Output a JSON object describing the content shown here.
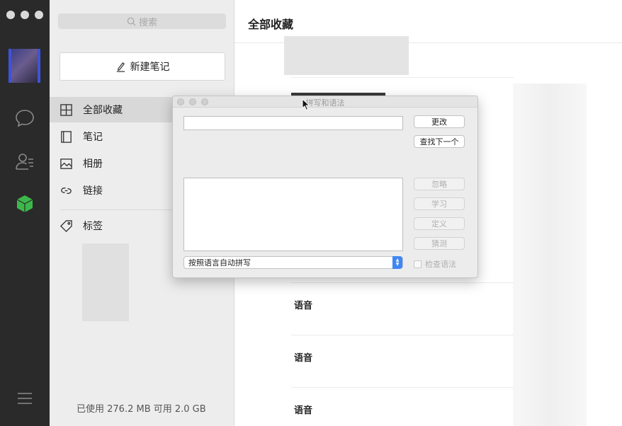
{
  "sidebar": {
    "search_placeholder": "搜索",
    "new_note": "新建笔记",
    "items": [
      {
        "label": "全部收藏",
        "icon": "grid-icon",
        "active": true
      },
      {
        "label": "笔记",
        "icon": "notebook-icon",
        "active": false
      },
      {
        "label": "相册",
        "icon": "image-icon",
        "active": false
      },
      {
        "label": "链接",
        "icon": "link-icon",
        "active": false
      },
      {
        "label": "标签",
        "icon": "tag-icon",
        "active": false
      }
    ],
    "storage": "已使用 276.2 MB 可用 2.0 GB"
  },
  "main": {
    "title": "全部收藏",
    "voice_labels": [
      "语音",
      "语音",
      "语音"
    ]
  },
  "dialog": {
    "title": "拼写和语法",
    "change_button": "更改",
    "find_next_button": "查找下一个",
    "ignore_button": "忽略",
    "learn_button": "学习",
    "define_button": "定义",
    "guess_button": "猜测",
    "language_select": "按照语言自动拼写",
    "check_grammar": "检查语法"
  },
  "colors": {
    "rail": "#2a2a2a",
    "accent_green": "#3cb84a",
    "select_blue": "#3e86f5"
  }
}
